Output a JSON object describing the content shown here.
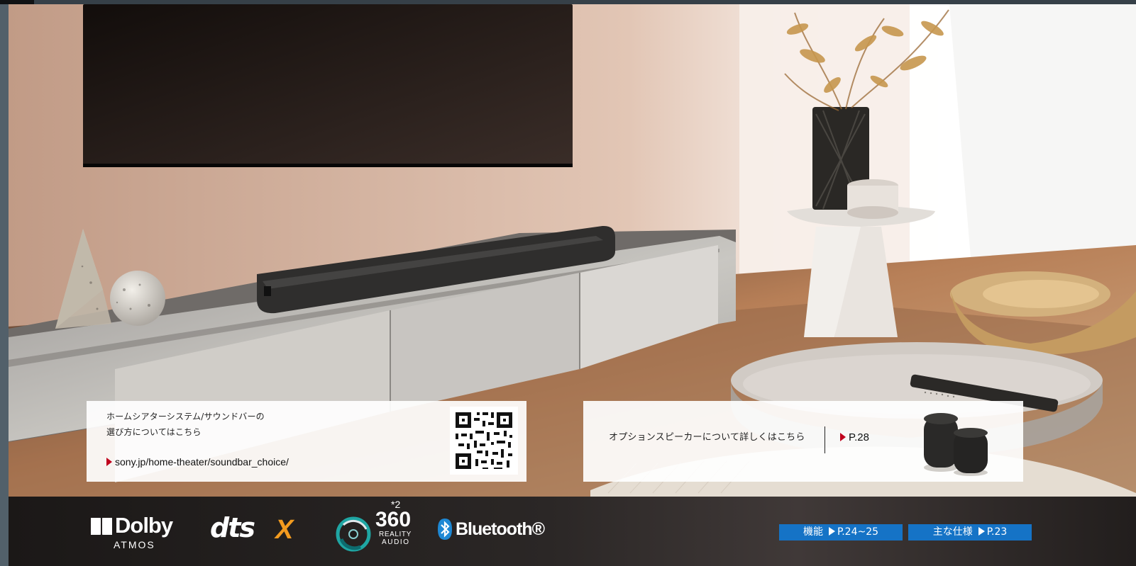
{
  "left_panel": {
    "line1": "ホームシアターシステム/サウンドバーの",
    "line2": "選び方についてはこちら",
    "url": "sony.jp/home-theater/soundbar_choice/"
  },
  "right_panel": {
    "text": "オプションスピーカーについて詳しくはこちら",
    "page_ref": "P.28"
  },
  "footer": {
    "logos": {
      "dolby_main": "Dolby",
      "dolby_sub": "ATMOS",
      "dts_main": "dts",
      "dts_x": "X",
      "reality_note": "*2",
      "reality_main": "360",
      "reality_sub1": "REALITY",
      "reality_sub2": "AUDIO",
      "bluetooth": "Bluetooth®"
    },
    "links": [
      {
        "label": "機能",
        "page": "P.24~25"
      },
      {
        "label": "主な仕様",
        "page": "P.23"
      }
    ]
  },
  "colors": {
    "link_blue": "#1573c6",
    "arrow_red": "#c0001d",
    "dts_orange": "#f39b1f",
    "footer_dark": "#231f1f"
  },
  "icons": {
    "url_arrow": "red-right-triangle",
    "page_arrow": "red-right-triangle",
    "qr_code": "qr-code-icon",
    "bluetooth": "bluetooth-icon",
    "reality": "360-reality-audio-icon"
  }
}
